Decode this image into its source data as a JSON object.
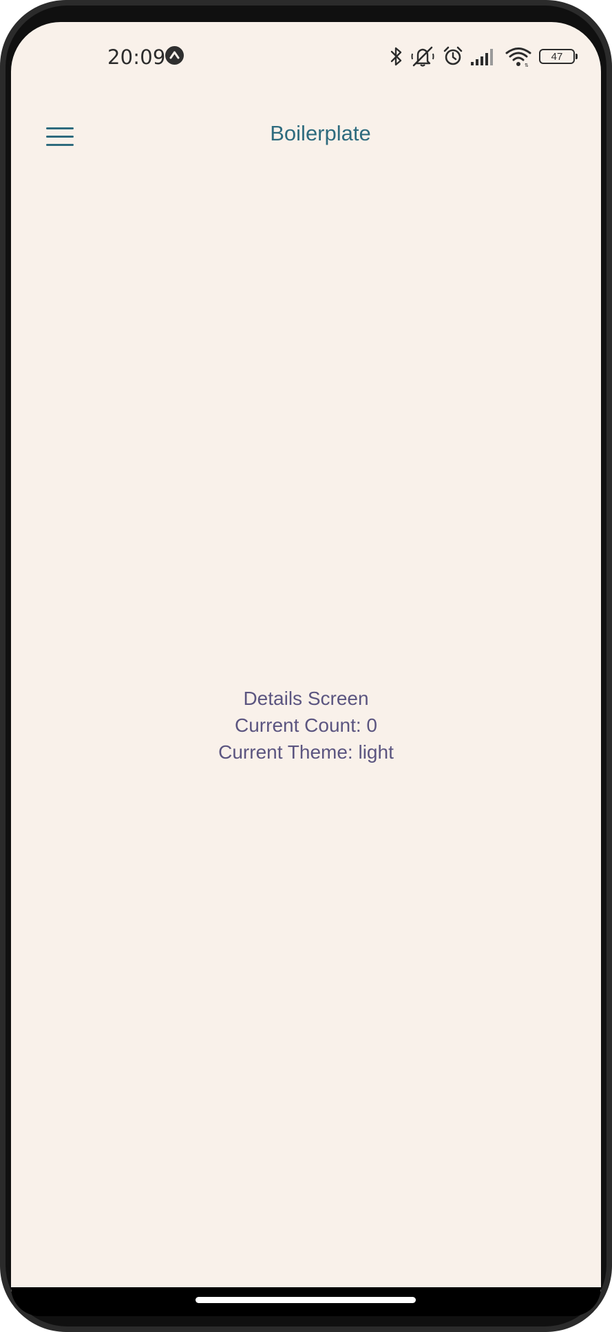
{
  "status_bar": {
    "time": "20:09",
    "battery_level": "47",
    "icons": [
      "app-notification-icon",
      "bluetooth-icon",
      "mute-icon",
      "alarm-icon",
      "cellular-signal-icon",
      "wifi-icon",
      "battery-icon"
    ]
  },
  "header": {
    "title": "Boilerplate",
    "menu_icon": "hamburger-menu-icon"
  },
  "details": {
    "heading": "Details Screen",
    "count_text": "Current Count: 0",
    "theme_text": "Current Theme: light"
  },
  "colors": {
    "background": "#f9f1ea",
    "accent": "#2e6b7e",
    "body_text": "#5b5580"
  }
}
